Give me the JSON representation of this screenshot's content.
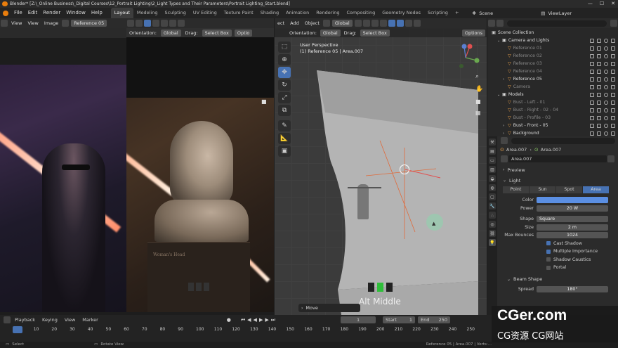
{
  "titlebar": {
    "text": "Blender* [Z:\\_Online Business\\_Digital Courses\\12_Portrait Lighting\\2_Light Types and Their Parameters\\Portrait Lighting_Start.blend]"
  },
  "menu": [
    "File",
    "Edit",
    "Render",
    "Window",
    "Help"
  ],
  "workspaces": [
    "Layout",
    "Modeling",
    "Sculpting",
    "UV Editing",
    "Texture Paint",
    "Shading",
    "Animation",
    "Rendering",
    "Compositing",
    "Geometry Nodes",
    "Scripting"
  ],
  "active_workspace": "Layout",
  "scene": "Scene",
  "viewlayer": "ViewLayer",
  "image_editor": {
    "view": "View",
    "view2": "View",
    "image": "Image",
    "image_name": "Reference 05"
  },
  "viewport_left_header": {
    "orientation_label": "Orientation:",
    "orientation": "Global",
    "drag_label": "Drag:",
    "drag": "Select Box",
    "options": "Optio"
  },
  "viewport": {
    "menu": [
      "ect",
      "Add",
      "Object"
    ],
    "orientation_label": "Orientation:",
    "orientation": "Global",
    "drag_label": "Drag:",
    "drag": "Select Box",
    "options": "Options",
    "perspective": "User Perspective",
    "collection_info": "(1) Reference 05 | Area.007",
    "hint": "Alt Middle",
    "operator": "Move"
  },
  "woman_head": "Woman's Head",
  "outliner": {
    "root": "Scene Collection",
    "items": [
      {
        "name": "Camera and Lights",
        "indent": 1,
        "dim": false,
        "sel": false
      },
      {
        "name": "Reference 01",
        "indent": 2,
        "dim": true,
        "sel": false
      },
      {
        "name": "Reference 02",
        "indent": 2,
        "dim": true,
        "sel": false
      },
      {
        "name": "Reference 03",
        "indent": 2,
        "dim": true,
        "sel": false
      },
      {
        "name": "Reference 04",
        "indent": 2,
        "dim": true,
        "sel": false
      },
      {
        "name": "Reference 05",
        "indent": 2,
        "dim": false,
        "sel": false
      },
      {
        "name": "Camera",
        "indent": 2,
        "dim": true,
        "sel": false
      },
      {
        "name": "Models",
        "indent": 1,
        "dim": false,
        "sel": false
      },
      {
        "name": "Bust - Left - 01",
        "indent": 2,
        "dim": true,
        "sel": false
      },
      {
        "name": "Bust - Right - 02 - 04",
        "indent": 2,
        "dim": true,
        "sel": false
      },
      {
        "name": "Bust - Profile - 03",
        "indent": 2,
        "dim": true,
        "sel": false
      },
      {
        "name": "Bust - Front - 05",
        "indent": 2,
        "dim": false,
        "sel": false
      },
      {
        "name": "Background",
        "indent": 2,
        "dim": false,
        "sel": false
      }
    ]
  },
  "properties": {
    "breadcrumb_a": "Area.007",
    "breadcrumb_b": "Area.007",
    "datablock": "Area.007",
    "preview": "Preview",
    "light": "Light",
    "light_types": [
      "Point",
      "Sun",
      "Spot",
      "Area"
    ],
    "active_type": "Area",
    "color_label": "Color",
    "color": "#5b8fe3",
    "power_label": "Power",
    "power": "20 W",
    "shape_label": "Shape",
    "shape": "Square",
    "size_label": "Size",
    "size": "2 m",
    "bounces_label": "Max Bounces",
    "bounces": "1024",
    "checks": [
      {
        "label": "Cast Shadow",
        "on": true
      },
      {
        "label": "Multiple Importance",
        "on": true
      },
      {
        "label": "Shadow Caustics",
        "on": false
      },
      {
        "label": "Portal",
        "on": false
      }
    ],
    "beam_shape": "Beam Shape",
    "spread_label": "Spread",
    "spread": "180°"
  },
  "timeline": {
    "menu": [
      "Playback",
      "Keying",
      "View",
      "Marker"
    ],
    "current": "1",
    "start_label": "Start",
    "start": "1",
    "end_label": "End",
    "end": "250",
    "ticks": [
      "1",
      "10",
      "20",
      "30",
      "40",
      "50",
      "60",
      "70",
      "80",
      "90",
      "100",
      "110",
      "120",
      "130",
      "140",
      "150",
      "160",
      "170",
      "180",
      "190",
      "200",
      "210",
      "220",
      "230",
      "240",
      "250"
    ]
  },
  "status": {
    "select": "Select",
    "rotate": "Rotate View",
    "info": "Reference 05 | Area.007 | Verts:..."
  },
  "watermark": {
    "big": "CGer.com",
    "small": "CG资源 CG网站"
  }
}
